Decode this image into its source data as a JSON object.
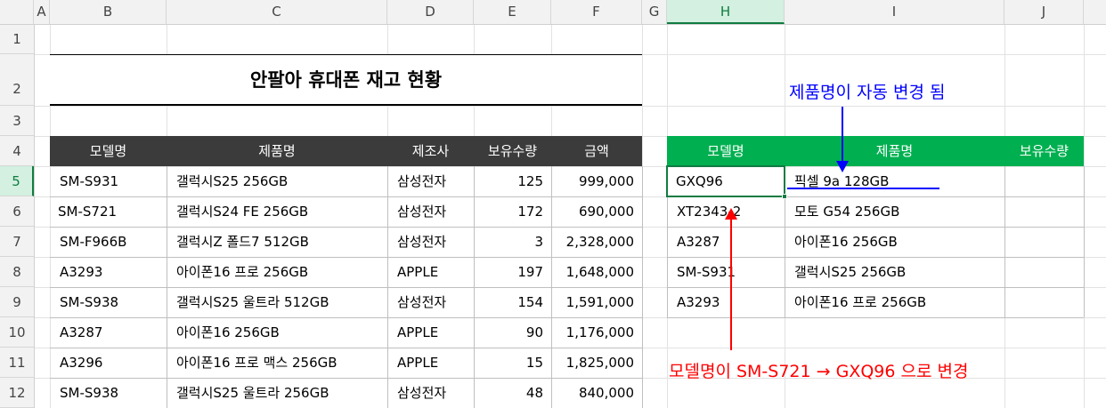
{
  "columns": [
    "A",
    "B",
    "C",
    "D",
    "E",
    "F",
    "G",
    "H",
    "I",
    "J"
  ],
  "rows": [
    "1",
    "2",
    "3",
    "4",
    "5",
    "6",
    "7",
    "8",
    "9",
    "10",
    "11",
    "12"
  ],
  "title": "안팔아 휴대폰 재고 현황",
  "main_table": {
    "headers": [
      "모델명",
      "제품명",
      "제조사",
      "보유수량",
      "금액"
    ],
    "rows": [
      [
        "SM-S931",
        "갤럭시S25 256GB",
        "삼성전자",
        "125",
        "999,000"
      ],
      [
        "SM-S721",
        "갤럭시S24 FE 256GB",
        "삼성전자",
        "172",
        "690,000"
      ],
      [
        "SM-F966B",
        "갤럭시Z 폴드7 512GB",
        "삼성전자",
        "3",
        "2,328,000"
      ],
      [
        "A3293",
        "아이폰16 프로 256GB",
        "APPLE",
        "197",
        "1,648,000"
      ],
      [
        "SM-S938",
        "갤럭시S25 울트라 512GB",
        "삼성전자",
        "154",
        "1,591,000"
      ],
      [
        "A3287",
        "아이폰16 256GB",
        "APPLE",
        "90",
        "1,176,000"
      ],
      [
        "A3296",
        "아이폰16 프로 맥스 256GB",
        "APPLE",
        "15",
        "1,825,000"
      ],
      [
        "SM-S938",
        "갤럭시S25 울트라 256GB",
        "삼성전자",
        "48",
        "840,000"
      ]
    ]
  },
  "lookup_table": {
    "headers": [
      "모델명",
      "제품명",
      "보유수량"
    ],
    "rows": [
      [
        "GXQ96",
        "픽셀 9a 128GB",
        ""
      ],
      [
        "XT2343-2",
        "모토 G54 256GB",
        ""
      ],
      [
        "A3287",
        "아이폰16 256GB",
        ""
      ],
      [
        "SM-S931",
        "갤럭시S25 256GB",
        ""
      ],
      [
        "A3293",
        "아이폰16 프로 256GB",
        ""
      ]
    ]
  },
  "annotations": {
    "top": "제품명이 자동 변경 됨",
    "bottom": "모델명이 SM-S721 → GXQ96 으로 변경"
  },
  "colors": {
    "dark_header": "#3b3b3b",
    "green_header": "#00b050",
    "annotation_top": "#0000ff",
    "annotation_bottom": "#ff0000",
    "active_cell": "#107c41"
  }
}
